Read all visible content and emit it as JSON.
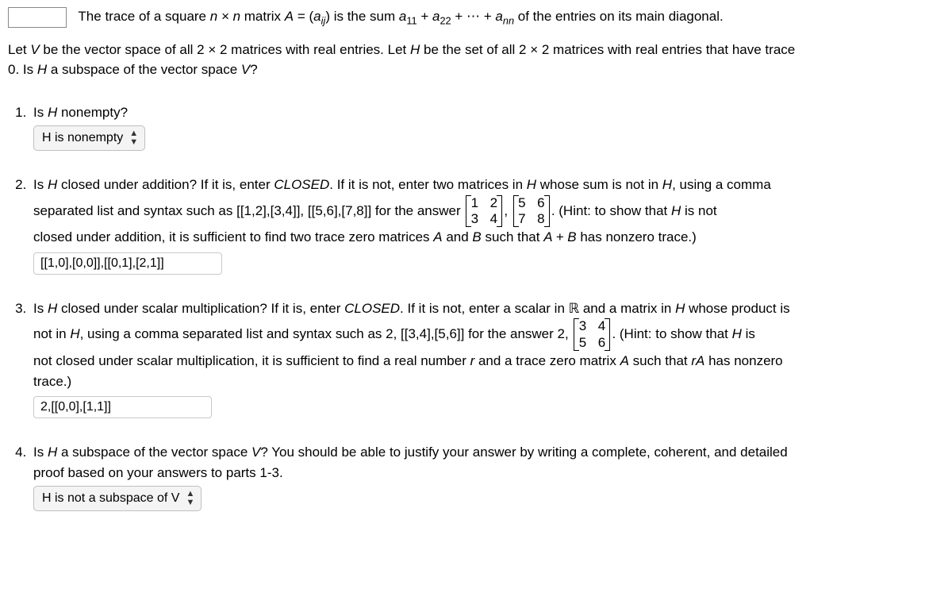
{
  "intro": {
    "pre": "The trace of a square ",
    "nxn": "n × n",
    "mid1": " matrix ",
    "A": "A",
    "eq": " = (",
    "aij": "a",
    "aij_sub": "ij",
    "mid2": ") is the sum ",
    "a11": "a",
    "a11_sub": "11",
    "plus1": " + ",
    "a22": "a",
    "a22_sub": "22",
    "plus2": " + ⋯ + ",
    "ann": "a",
    "ann_sub": "nn",
    "end": " of the entries on its main diagonal."
  },
  "statement": {
    "l1a": "Let ",
    "V": "V",
    "l1b": " be the vector space of all ",
    "two": "2 × 2",
    "l1c": " matrices with real entries. Let ",
    "H": "H",
    "l1d": " be the set of all ",
    "l1e": " matrices with real entries that have trace ",
    "l2a": "0. Is ",
    "l2b": " a subspace of the vector space ",
    "l2c": "?"
  },
  "q1": {
    "prompt_a": "Is ",
    "prompt_b": " nonempty?",
    "select_value": "H is nonempty"
  },
  "q2": {
    "p1a": "Is ",
    "p1b": " closed under addition? If it is, enter ",
    "closed": "CLOSED",
    "p1c": ". If it is not, enter two matrices in ",
    "p1d": " whose sum is not in ",
    "p1e": ", using a comma ",
    "p2a": "separated list and syntax such as ",
    "syntax": "[[1,2],[3,4]],  [[5,6],[7,8]]",
    "p2b": " for the answer ",
    "mat1": [
      [
        "1",
        "2"
      ],
      [
        "3",
        "4"
      ]
    ],
    "comma": ", ",
    "mat2": [
      [
        "5",
        "6"
      ],
      [
        "7",
        "8"
      ]
    ],
    "p2c": ". (Hint: to show that ",
    "p2d": " is not ",
    "p3a": "closed under addition, it is sufficient to find two trace zero matrices ",
    "Aa": "A",
    "p3b": " and ",
    "Bb": "B",
    "p3c": " such that ",
    "AB": "A + B",
    "p3d": " has nonzero trace.)",
    "input_value": "[[1,0],[0,0]],[[0,1],[2,1]]"
  },
  "q3": {
    "p1a": "Is ",
    "p1b": " closed under scalar multiplication? If it is, enter ",
    "closed": "CLOSED",
    "p1c": ". If it is not, enter a scalar in ",
    "R": "ℝ",
    "p1d": " and a matrix in ",
    "p1e": " whose product is ",
    "p2a": "not in ",
    "p2b": ", using a comma separated list and syntax such as ",
    "syntax": "2,  [[3,4],[5,6]]",
    "p2c": " for the answer ",
    "two": "2, ",
    "mat": [
      [
        "3",
        "4"
      ],
      [
        "5",
        "6"
      ]
    ],
    "p2d": ". (Hint: to show that ",
    "p2e": " is ",
    "p3a": "not closed under scalar multiplication, it is sufficient to find a real number ",
    "r": "r",
    "p3b": " and a trace zero matrix ",
    "A": "A",
    "p3c": " such that ",
    "rA": "rA",
    "p3d": " has nonzero ",
    "p4": "trace.)",
    "input_value": "2,[[0,0],[1,1]]"
  },
  "q4": {
    "p1a": "Is ",
    "p1b": " a subspace of the vector space ",
    "p1c": "? You should be able to justify your answer by writing a complete, coherent, and detailed ",
    "p2": "proof based on your answers to parts 1-3.",
    "select_value": "H is not a subspace of V"
  }
}
